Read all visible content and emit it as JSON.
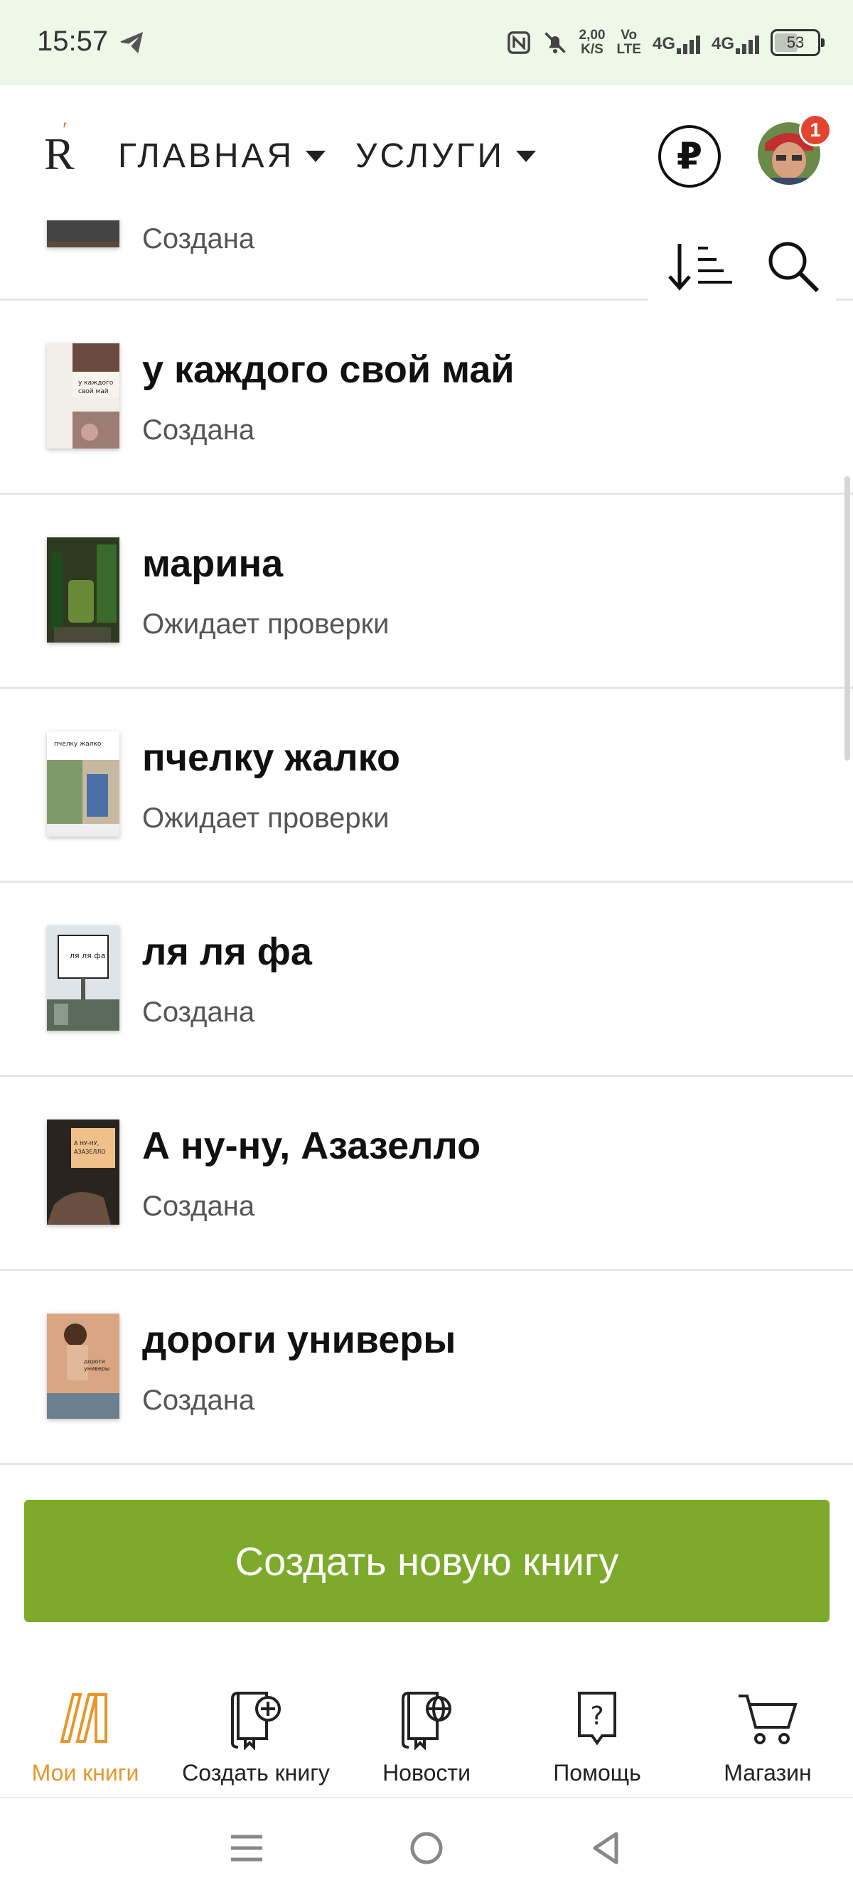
{
  "status_bar": {
    "time": "15:57",
    "speed_value": "2,00",
    "speed_unit": "K/S",
    "volte_top": "Vo",
    "volte_bottom": "LTE",
    "net1": "4G",
    "net2": "4G",
    "battery": "53"
  },
  "header": {
    "logo": "R",
    "nav": [
      {
        "label": "ГЛАВНАЯ"
      },
      {
        "label": "УСЛУГИ"
      }
    ],
    "notifications_count": "1"
  },
  "books": [
    {
      "title": "",
      "status": "Создана",
      "cover": "dark"
    },
    {
      "title": "у каждого свой май",
      "status": "Создана",
      "cover": "light"
    },
    {
      "title": "марина",
      "status": "Ожидает проверки",
      "cover": "green"
    },
    {
      "title": "пчелку жалко",
      "status": "Ожидает проверки",
      "cover": "photo"
    },
    {
      "title": "ля ля фа",
      "status": "Создана",
      "cover": "billboard"
    },
    {
      "title": "А ну-ну, Азазелло",
      "status": "Создана",
      "cover": "night"
    },
    {
      "title": "дороги универы",
      "status": "Создана",
      "cover": "beach"
    }
  ],
  "create_button": "Создать новую книгу",
  "tabs": [
    {
      "label": "Мои книги",
      "icon": "books-icon",
      "active": true
    },
    {
      "label": "Создать книгу",
      "icon": "create-book-icon",
      "active": false
    },
    {
      "label": "Новости",
      "icon": "news-icon",
      "active": false
    },
    {
      "label": "Помощь",
      "icon": "help-icon",
      "active": false
    },
    {
      "label": "Магазин",
      "icon": "cart-icon",
      "active": false
    }
  ],
  "colors": {
    "accent_green": "#7daa2b",
    "active_tab": "#e8962a",
    "badge": "#e3442f",
    "statusbar_bg": "#eef8e8"
  }
}
